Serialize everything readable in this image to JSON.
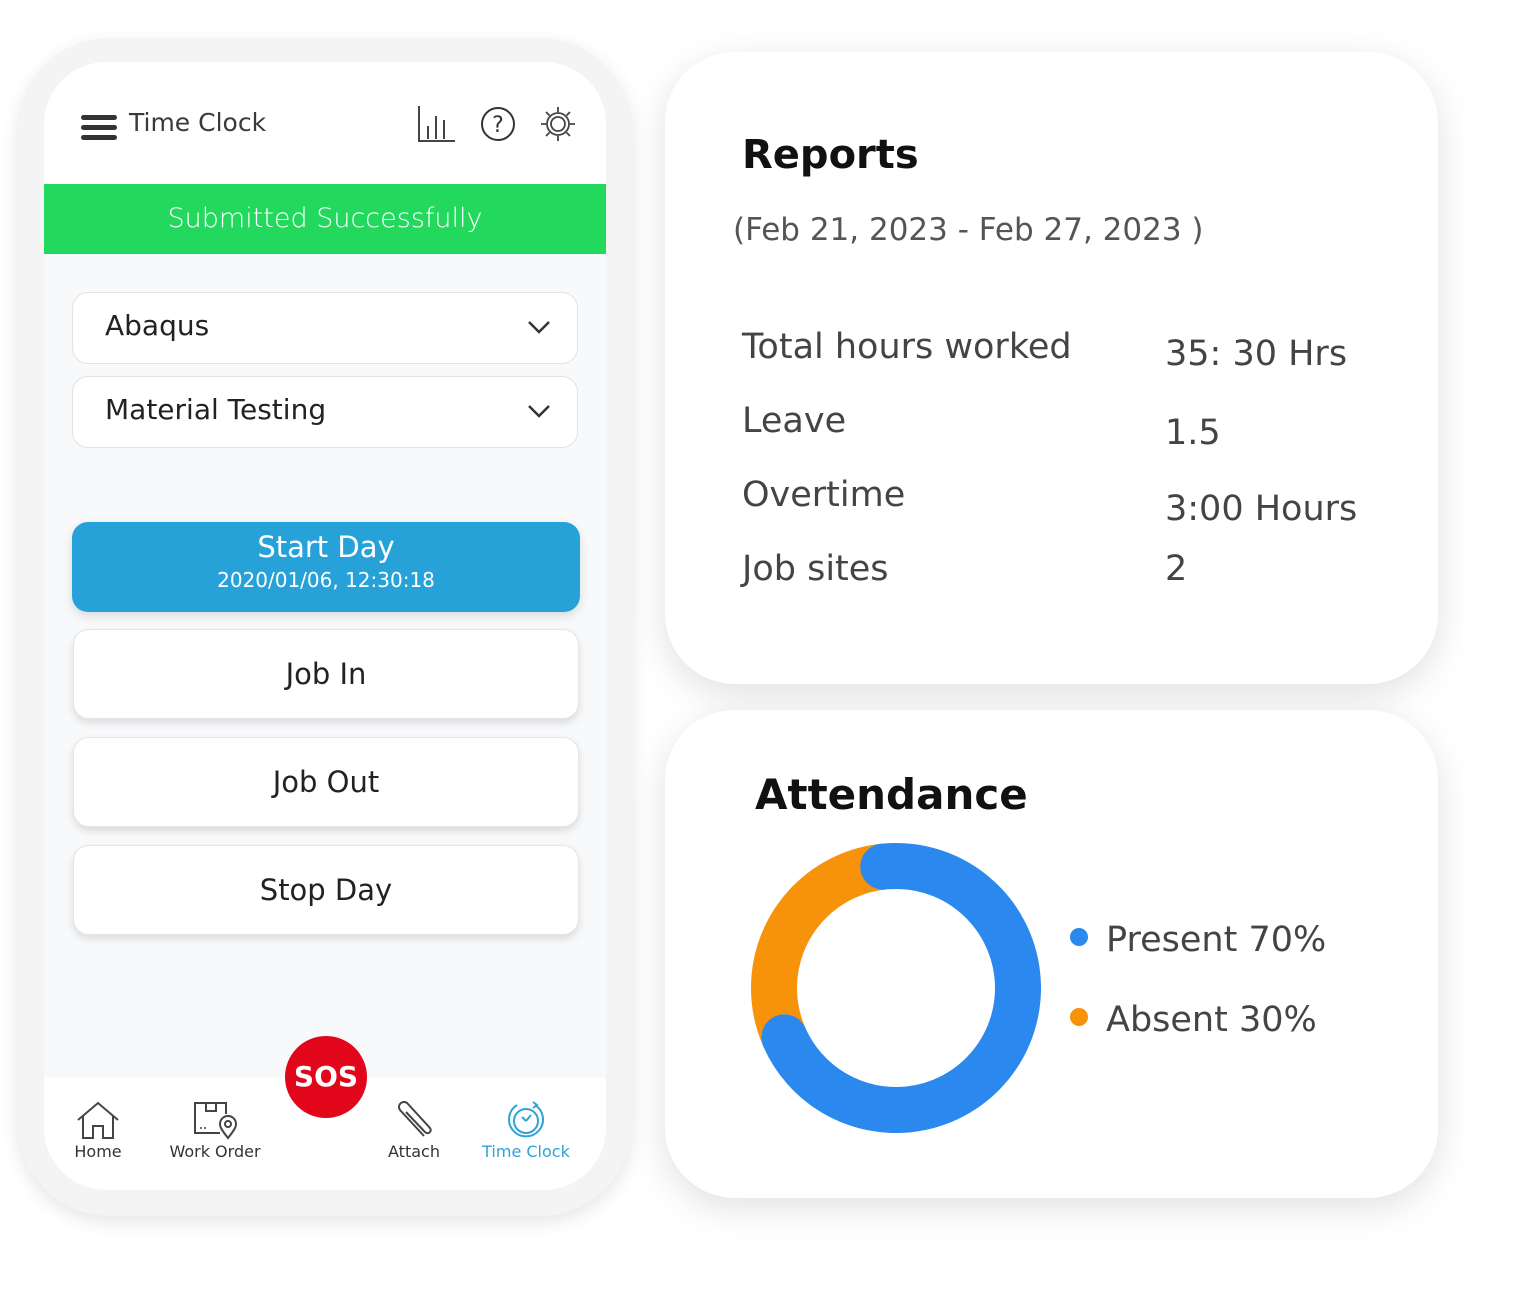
{
  "app": {
    "title": "Time Clock",
    "header_icons": [
      "bar-chart-icon",
      "help-icon",
      "gear-icon"
    ],
    "banner": "Submitted Successfully",
    "dropdowns": [
      {
        "value": "Abaqus"
      },
      {
        "value": "Material Testing"
      }
    ],
    "start_day": {
      "label": "Start Day",
      "timestamp": "2020/01/06, 12:30:18"
    },
    "buttons": [
      {
        "label": "Job In"
      },
      {
        "label": "Job Out"
      },
      {
        "label": "Stop Day"
      }
    ],
    "sos": "SOS",
    "nav": [
      {
        "label": "Home",
        "icon": "home-icon"
      },
      {
        "label": "Work Order",
        "icon": "work-order-icon"
      },
      {
        "label": "Attach",
        "icon": "paperclip-icon"
      },
      {
        "label": "Time Clock",
        "icon": "time-clock-icon",
        "active": true
      }
    ],
    "colors": {
      "banner": "#22d95e",
      "primary": "#27a2d8",
      "sos": "#e2061b",
      "active_nav": "#2da4d8"
    }
  },
  "reports": {
    "title": "Reports",
    "range": "(Feb 21, 2023 - Feb 27, 2023 )",
    "rows": [
      {
        "label": "Total hours worked",
        "value": "35: 30 Hrs"
      },
      {
        "label": "Leave",
        "value": "1.5"
      },
      {
        "label": "Overtime",
        "value": "3:00 Hours"
      },
      {
        "label": "Job sites",
        "value": "2"
      }
    ]
  },
  "attendance": {
    "title": "Attendance",
    "legend": [
      {
        "label": "Present 70%"
      },
      {
        "label": "Absent 30%"
      }
    ]
  },
  "chart_data": {
    "type": "pie",
    "title": "Attendance",
    "categories": [
      "Present",
      "Absent"
    ],
    "values": [
      70,
      30
    ],
    "colors": [
      "#2a88ef",
      "#f7930a"
    ],
    "donut": true,
    "legend": "right"
  }
}
